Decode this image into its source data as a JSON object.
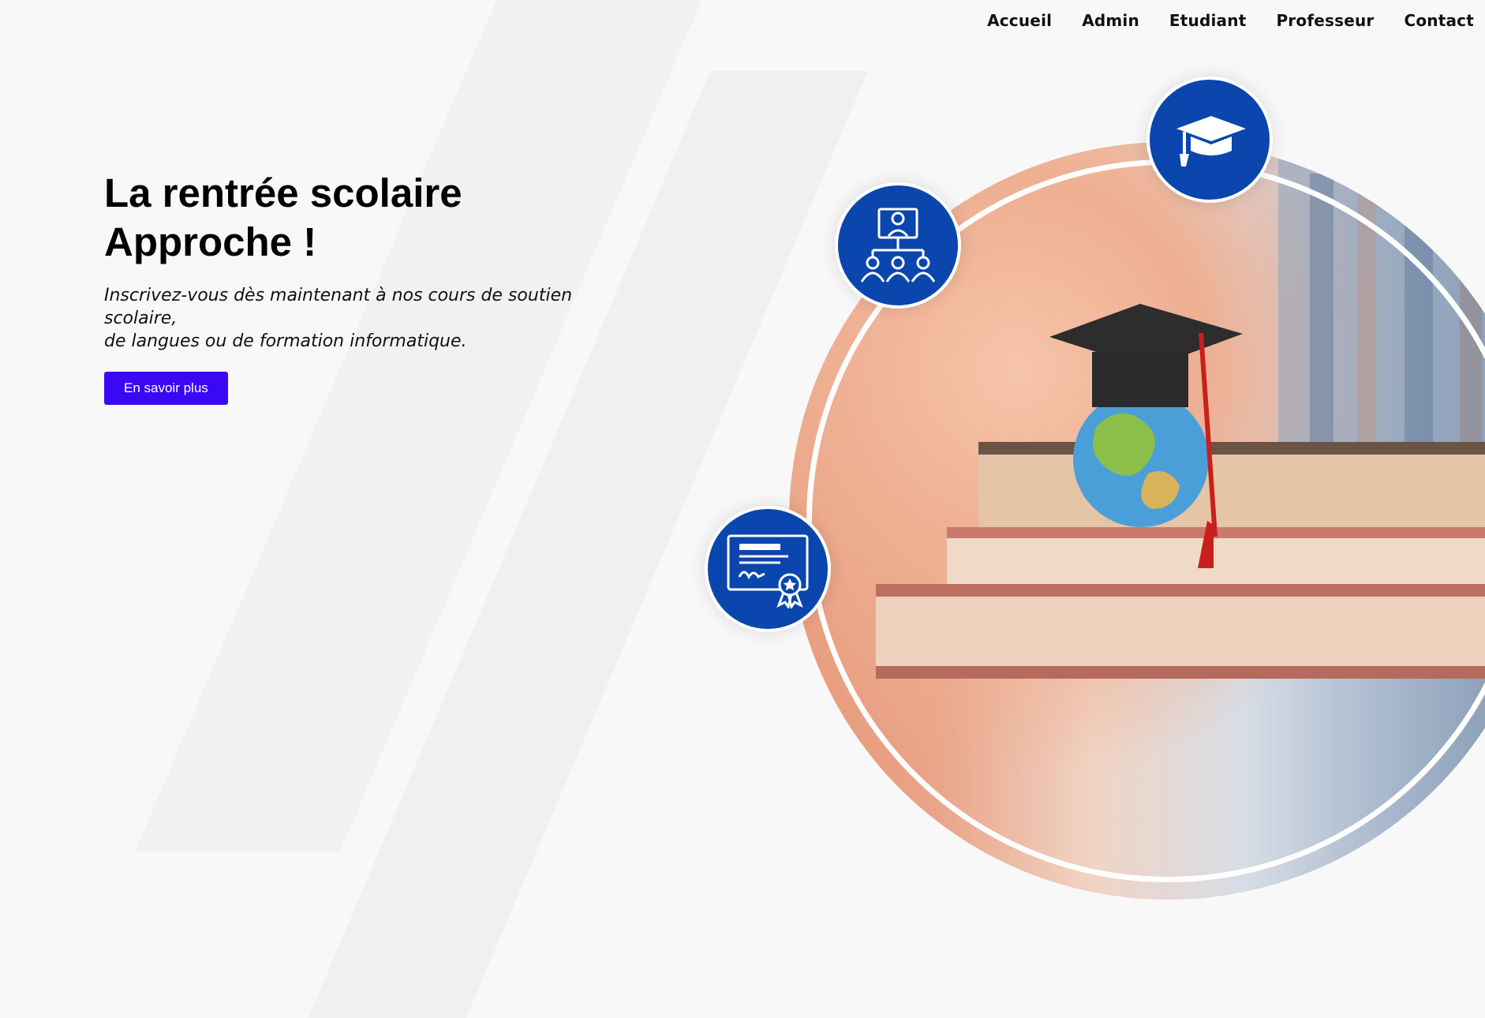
{
  "nav": {
    "items": [
      {
        "label": "Accueil"
      },
      {
        "label": "Admin"
      },
      {
        "label": "Etudiant"
      },
      {
        "label": "Professeur"
      },
      {
        "label": "Contact"
      }
    ]
  },
  "hero": {
    "title_line1": "La rentrée scolaire",
    "title_line2": "Approche !",
    "subtitle_line1": "Inscrivez-vous dès maintenant à nos cours de soutien scolaire,",
    "subtitle_line2": "de langues ou de formation informatique.",
    "cta_label": "En savoir plus"
  },
  "icons": {
    "top": "graduation-cap-icon",
    "middle": "classroom-people-icon",
    "bottom": "certificate-icon"
  },
  "colors": {
    "accent": "#3a08f5",
    "badge": "#0a46ad",
    "background": "#f8f8f8"
  }
}
